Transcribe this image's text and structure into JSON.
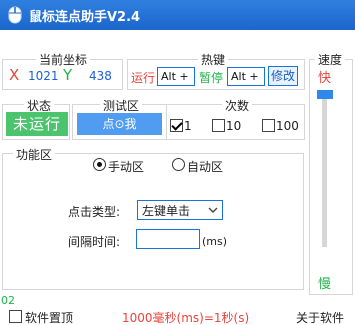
{
  "app": {
    "title": "鼠标连点助手V2.4"
  },
  "coords": {
    "legend": "当前坐标",
    "x_label": "X",
    "x_value": "1021",
    "y_label": "Y",
    "y_value": "438"
  },
  "hotkey": {
    "legend": "热键",
    "run_label": "运行",
    "run_key": "Alt +",
    "pause_label": "暂停",
    "pause_key": "Alt +",
    "edit_button": "修改"
  },
  "speed": {
    "legend": "速度",
    "fast_label": "快",
    "slow_label": "慢"
  },
  "status": {
    "legend": "状态",
    "value": "未运行"
  },
  "test": {
    "legend": "测试区",
    "button_label": "点⊙我"
  },
  "count": {
    "legend": "次数",
    "options": [
      {
        "label": "1",
        "checked": true
      },
      {
        "label": "10",
        "checked": false
      },
      {
        "label": "100",
        "checked": false
      }
    ]
  },
  "function": {
    "legend": "功能区",
    "modes": [
      {
        "label": "手动区",
        "checked": true
      },
      {
        "label": "自动区",
        "checked": false
      }
    ],
    "click_type_label": "点击类型:",
    "click_type_value": "左键单击",
    "interval_label": "间隔时间:",
    "interval_value": "",
    "interval_unit": "(ms)"
  },
  "footer": {
    "corner_value": "02",
    "pin_label": "软件置顶",
    "pin_checked": false,
    "hint": "1000毫秒(ms)=1秒(s)",
    "about": "关于软件"
  },
  "colors": {
    "titlebar": "#1c66cc",
    "accent": "#1a73d9",
    "status_green": "#4cc46e",
    "red": "#e8453c",
    "green": "#21b34a"
  }
}
